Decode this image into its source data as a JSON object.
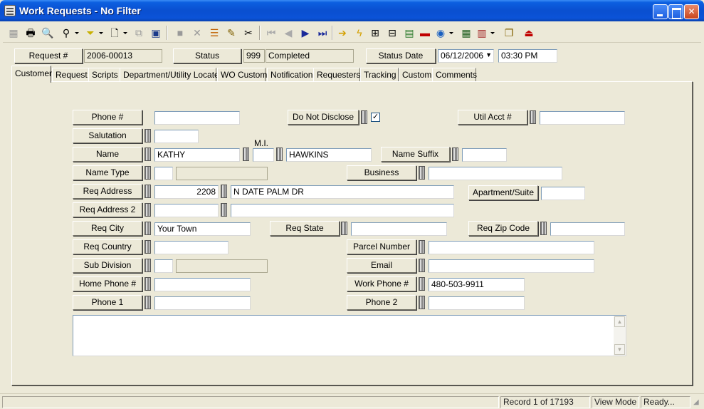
{
  "window": {
    "title": "Work Requests - No Filter"
  },
  "toolbar": {
    "icons": [
      "grid-icon",
      "print-icon",
      "print-preview-icon",
      "binoculars-icon",
      "filter-icon",
      "document-icon",
      "copy-icon",
      "paste-icon",
      "page-icon",
      "save-icon",
      "delete-icon",
      "stack-icon",
      "pencil-icon",
      "scissors-icon",
      "first-record-icon",
      "previous-record-icon",
      "next-record-icon",
      "last-record-icon",
      "arrow-right-icon",
      "lightning-icon",
      "tree-icon",
      "hierarchy-icon",
      "map-icon",
      "truck-icon",
      "globe-icon",
      "calculator-icon",
      "books-icon",
      "new-window-icon",
      "exit-icon"
    ]
  },
  "header": {
    "request_label": "Request #",
    "request_value": "2006-00013",
    "status_label": "Status",
    "status_code": "999",
    "status_value": "Completed",
    "status_date_label": "Status Date",
    "status_date_value": "06/12/2006",
    "status_time_value": "03:30 PM"
  },
  "tabs": [
    "Customer",
    "Request",
    "Scripts",
    "Department/Utility Locates",
    "WO Custom",
    "Notification",
    "Requesters",
    "Tracking",
    "Custom",
    "Comments"
  ],
  "active_tab": "Customer",
  "form": {
    "phone_label": "Phone #",
    "phone_value": "",
    "do_not_disclose_label": "Do Not Disclose",
    "do_not_disclose_checked": "✓",
    "util_acct_label": "Util Acct #",
    "util_acct_value": "",
    "salutation_label": "Salutation",
    "salutation_value": "",
    "mi_label": "M.I.",
    "name_label": "Name",
    "first_name": "KATHY",
    "middle_initial": "",
    "last_name": "HAWKINS",
    "name_suffix_label": "Name Suffix",
    "name_suffix_value": "",
    "name_type_label": "Name Type",
    "name_type_code": "",
    "name_type_desc": "",
    "business_label": "Business",
    "business_value": "",
    "req_address_label": "Req Address",
    "address_number": "2208",
    "address_street": "N DATE PALM DR",
    "apartment_label": "Apartment/Suite",
    "apartment_value": "",
    "req_address2_label": "Req Address 2",
    "address2_number": "",
    "address2_street": "",
    "req_city_label": "Req City",
    "req_city_value": "Your Town",
    "req_state_label": "Req State",
    "req_state_value": "",
    "req_zip_label": "Req Zip Code",
    "req_zip_value": "",
    "req_country_label": "Req Country",
    "req_country_value": "",
    "parcel_label": "Parcel Number",
    "parcel_value": "",
    "subdivision_label": "Sub Division",
    "subdivision_code": "",
    "subdivision_desc": "",
    "email_label": "Email",
    "email_value": "",
    "home_phone_label": "Home Phone #",
    "home_phone_value": "",
    "work_phone_label": "Work Phone #",
    "work_phone_value": "480-503-9911",
    "phone1_label": "Phone 1",
    "phone1_value": "",
    "phone2_label": "Phone 2",
    "phone2_value": "",
    "notes_value": ""
  },
  "statusbar": {
    "record": "Record 1 of 17193",
    "mode": "View Mode",
    "state": "Ready..."
  }
}
